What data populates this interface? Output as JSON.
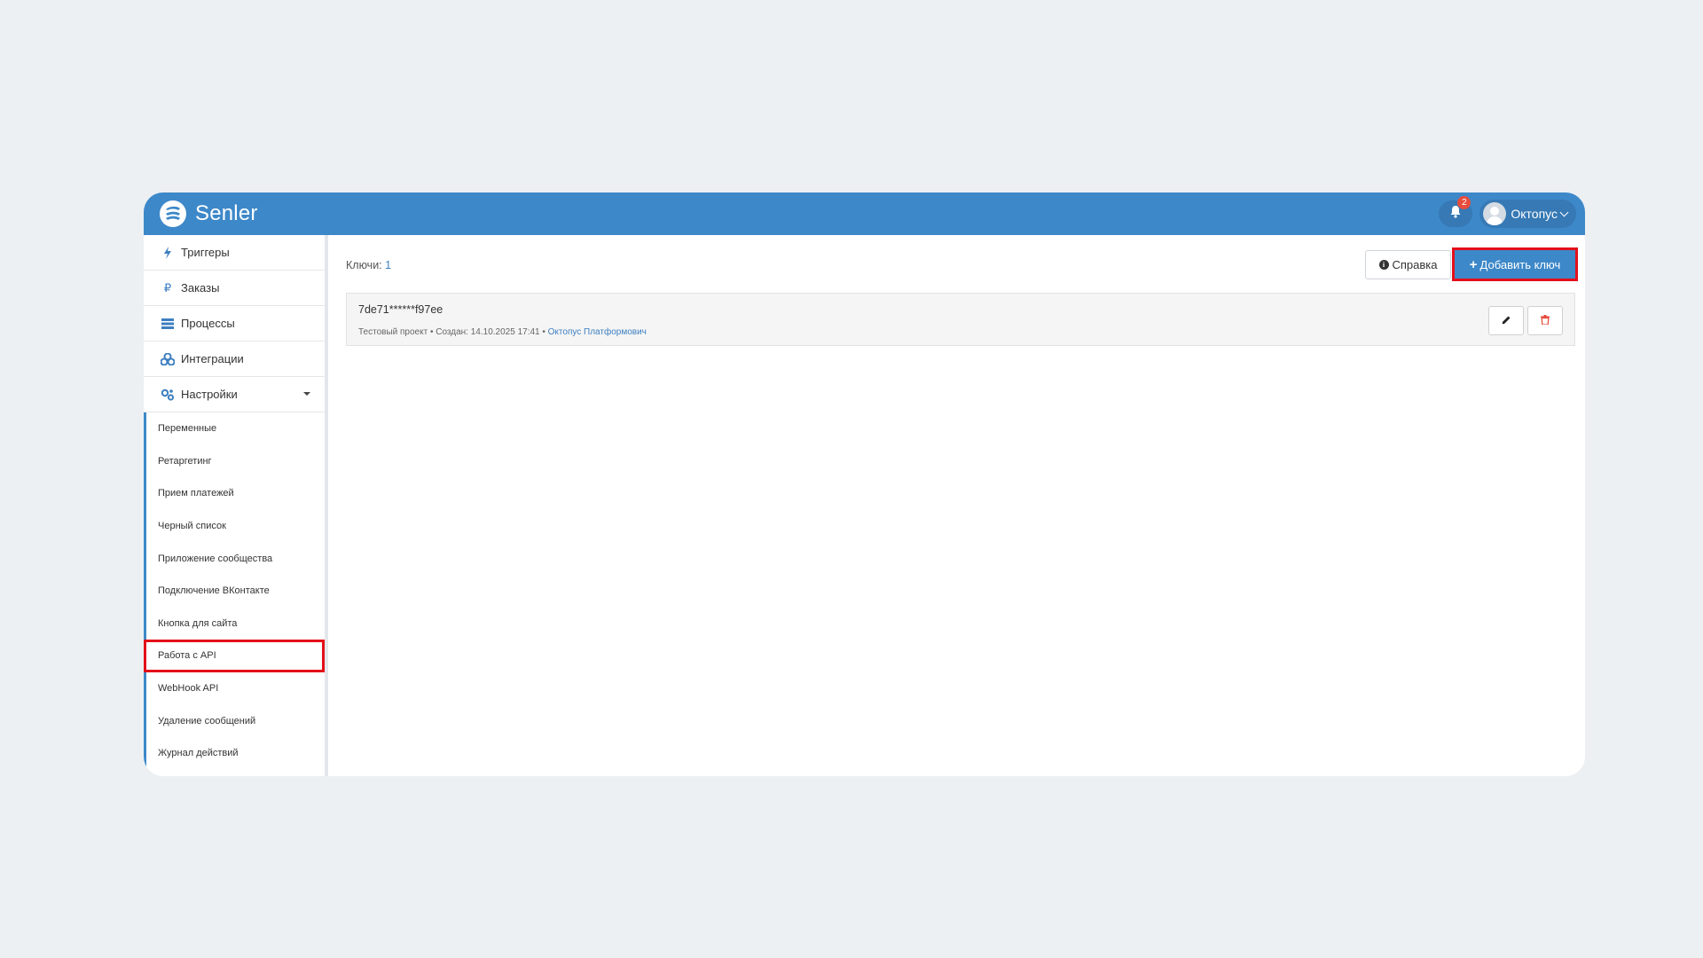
{
  "brand": {
    "name": "Senler"
  },
  "header": {
    "notifications_count": "2",
    "user_name": "Октопус"
  },
  "sidebar": {
    "items": [
      {
        "label": "Триггеры",
        "icon": "bolt-icon"
      },
      {
        "label": "Заказы",
        "icon": "ruble-icon"
      },
      {
        "label": "Процессы",
        "icon": "list-icon"
      },
      {
        "label": "Интеграции",
        "icon": "cubes-icon"
      },
      {
        "label": "Настройки",
        "icon": "gears-icon"
      }
    ],
    "subitems": [
      "Переменные",
      "Ретаргетинг",
      "Прием платежей",
      "Черный список",
      "Приложение сообщества",
      "Подключение ВКонтакте",
      "Кнопка для сайта",
      "Работа с API",
      "WebHook API",
      "Удаление сообщений",
      "Журнал действий"
    ],
    "active_subitem": "Работа с API"
  },
  "main": {
    "keys_label": "Ключи:",
    "keys_count": "1",
    "help_label": "Справка",
    "add_key_label": "Добавить ключ",
    "keys": [
      {
        "value": "7de71******f97ee",
        "meta": "Тестовый проект • Создан: 14.10.2025 17:41 •",
        "author": "Октопус Платформович"
      }
    ]
  },
  "colors": {
    "header": "#3d88c9",
    "accent": "#3d7fc0",
    "highlight": "#e3101a",
    "danger": "#e74c3c"
  }
}
